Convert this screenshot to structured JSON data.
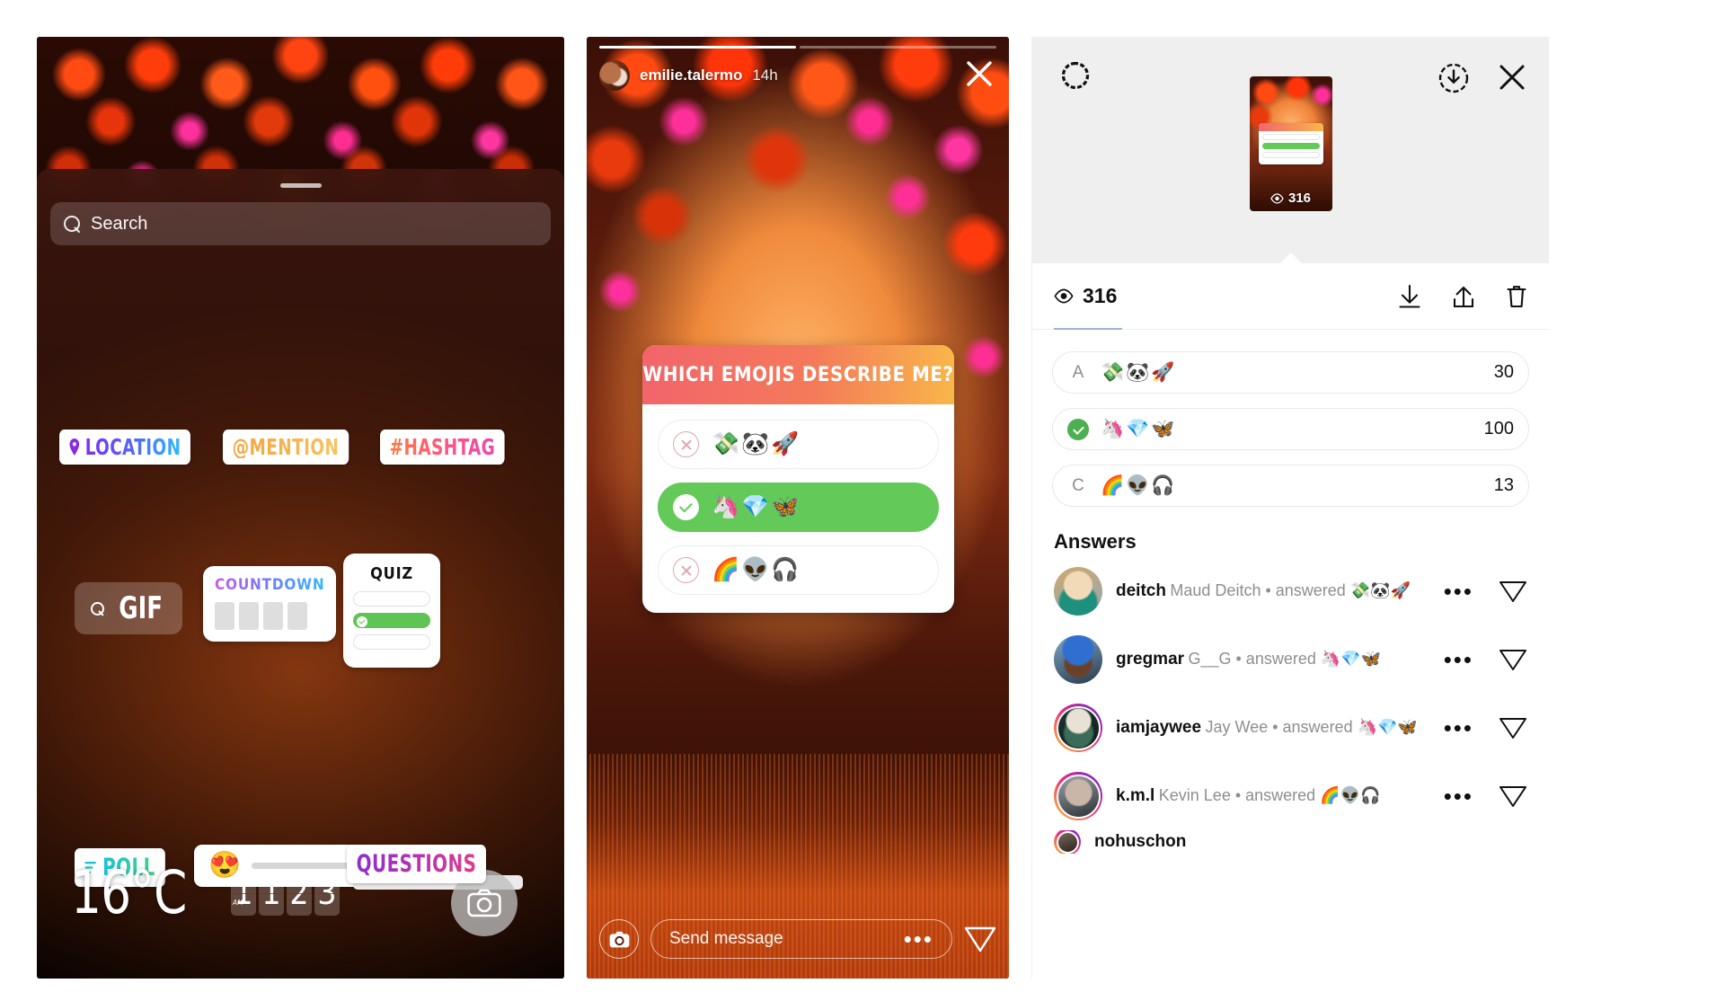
{
  "panel1": {
    "search": {
      "placeholder": "Search",
      "icon": "search-icon"
    },
    "stickers_row1": [
      {
        "label": "LOCATION",
        "icon": "location-pin-icon"
      },
      {
        "label": "@MENTION",
        "icon": "mention-icon"
      },
      {
        "label": "#HASHTAG",
        "icon": "hashtag-icon"
      }
    ],
    "gif": {
      "label": "GIF",
      "icon": "search-icon"
    },
    "countdown": {
      "label": "COUNTDOWN",
      "digits": 4
    },
    "quiz": {
      "label": "QUIZ",
      "options": 3,
      "correct_index": 1
    },
    "poll": {
      "label": "POLL",
      "icon": "poll-bars-icon"
    },
    "emoji_slider": {
      "emoji": "😍"
    },
    "questions": {
      "label": "QUESTIONS"
    },
    "weather": {
      "value": "16°C"
    },
    "clock": {
      "meridiem": "AM",
      "digits": [
        "1",
        "1",
        "2",
        "3"
      ]
    },
    "camera_button": {
      "icon": "camera-icon"
    }
  },
  "panel2": {
    "username": "emilie.talermo",
    "timestamp": "14h",
    "close_icon": "close-icon",
    "avatar": "story-avatar",
    "quiz": {
      "title": "WHICH EMOJIS DESCRIBE ME?",
      "options": [
        {
          "emoji": "💸🐼🚀",
          "state": "wrong",
          "marker": "x-circle-icon"
        },
        {
          "emoji": "🦄💎🦋",
          "state": "correct",
          "marker": "check-circle-icon"
        },
        {
          "emoji": "🌈👽🎧",
          "state": "wrong",
          "marker": "x-circle-icon"
        }
      ]
    },
    "footer": {
      "camera_icon": "camera-icon",
      "message_placeholder": "Send message",
      "more_icon": "ellipsis-icon",
      "send_icon": "send-paper-plane-icon"
    }
  },
  "panel3": {
    "header": {
      "gear_icon": "gear-icon",
      "download_icon": "download-circle-icon",
      "close_icon": "close-icon"
    },
    "thumbnail": {
      "views": "316",
      "views_icon": "eye-icon"
    },
    "stats": {
      "views_icon": "eye-icon",
      "views": "316",
      "actions": [
        {
          "icon": "download-icon"
        },
        {
          "icon": "share-icon"
        },
        {
          "icon": "trash-icon"
        }
      ]
    },
    "results": [
      {
        "letter": "A",
        "emoji": "💸🐼🚀",
        "count": "30",
        "correct": false
      },
      {
        "letter": "",
        "emoji": "🦄💎🦋",
        "count": "100",
        "correct": true
      },
      {
        "letter": "C",
        "emoji": "🌈👽🎧",
        "count": "13",
        "correct": false
      }
    ],
    "answers_title": "Answers",
    "answers": [
      {
        "username": "deitch",
        "subtitle": "Maud Deitch • answered 💸🐼🚀",
        "ring": false
      },
      {
        "username": "gregmar",
        "subtitle": "G__G • answered 🦄💎🦋",
        "ring": false
      },
      {
        "username": "iamjaywee",
        "subtitle": "Jay Wee • answered 🦄💎🦋",
        "ring": true
      },
      {
        "username": "k.m.l",
        "subtitle": "Kevin Lee • answered 🌈👽🎧",
        "ring": true
      },
      {
        "username": "nohuschon",
        "subtitle": "",
        "ring": true
      }
    ],
    "row_actions": {
      "more_icon": "ellipsis-icon",
      "send_icon": "send-paper-plane-icon"
    }
  }
}
